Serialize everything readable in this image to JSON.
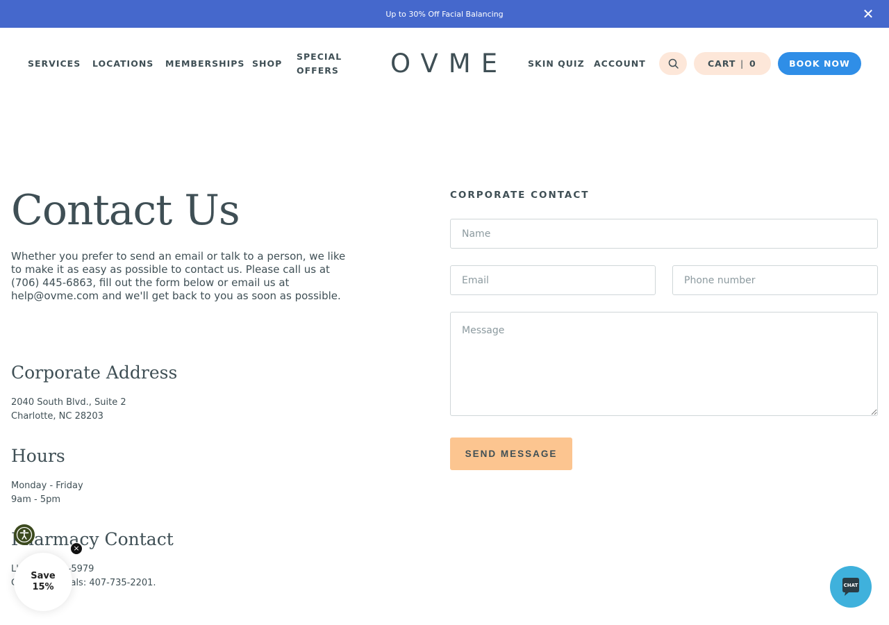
{
  "announcement": {
    "text": "Up to 30% Off Facial Balancing",
    "background": "#4568cc"
  },
  "header": {
    "nav_left": [
      "SERVICES",
      "LOCATIONS",
      "MEMBERSHIPS",
      "SHOP",
      "SPECIAL OFFERS"
    ],
    "logo": "OVME",
    "nav_right": [
      "SKIN QUIZ",
      "ACCOUNT"
    ],
    "search_icon": "search-icon",
    "cart": {
      "label": "CART",
      "separator": "|",
      "count": "0"
    },
    "book_now": "BOOK NOW",
    "accent_color": "#2f8ee7",
    "pill_color": "#fde7d9"
  },
  "main": {
    "title": "Contact Us",
    "intro": "Whether you prefer to send an email or talk to a person, we like to make it as easy as possible to contact us. Please call us at (706) 445-6863, fill out the form below or email us at help@ovme.com and we'll get back to you as soon as possible.",
    "address": {
      "heading": "Corporate Address",
      "lines": [
        "2040 South Blvd., Suite 2",
        "Charlotte, NC 28203"
      ]
    },
    "hours": {
      "heading": "Hours",
      "lines": [
        "Monday - Friday",
        "9am - 5pm"
      ]
    },
    "pharmacy": {
      "heading": "Pharmacy Contact",
      "lines": [
        "L'... 800-545-5979",
        "C... maceuticals: 407-735-2201."
      ]
    }
  },
  "form": {
    "title": "CORPORATE CONTACT",
    "name_placeholder": "Name",
    "email_placeholder": "Email",
    "phone_placeholder": "Phone number",
    "message_placeholder": "Message",
    "submit": "SEND MESSAGE",
    "submit_color": "#fcc590"
  },
  "widgets": {
    "accessibility_icon": "accessibility-icon",
    "save_badge": [
      "Save",
      "15%"
    ],
    "save_close": "×",
    "chat_label": "CHAT",
    "chat_color": "#3fb1dc"
  }
}
